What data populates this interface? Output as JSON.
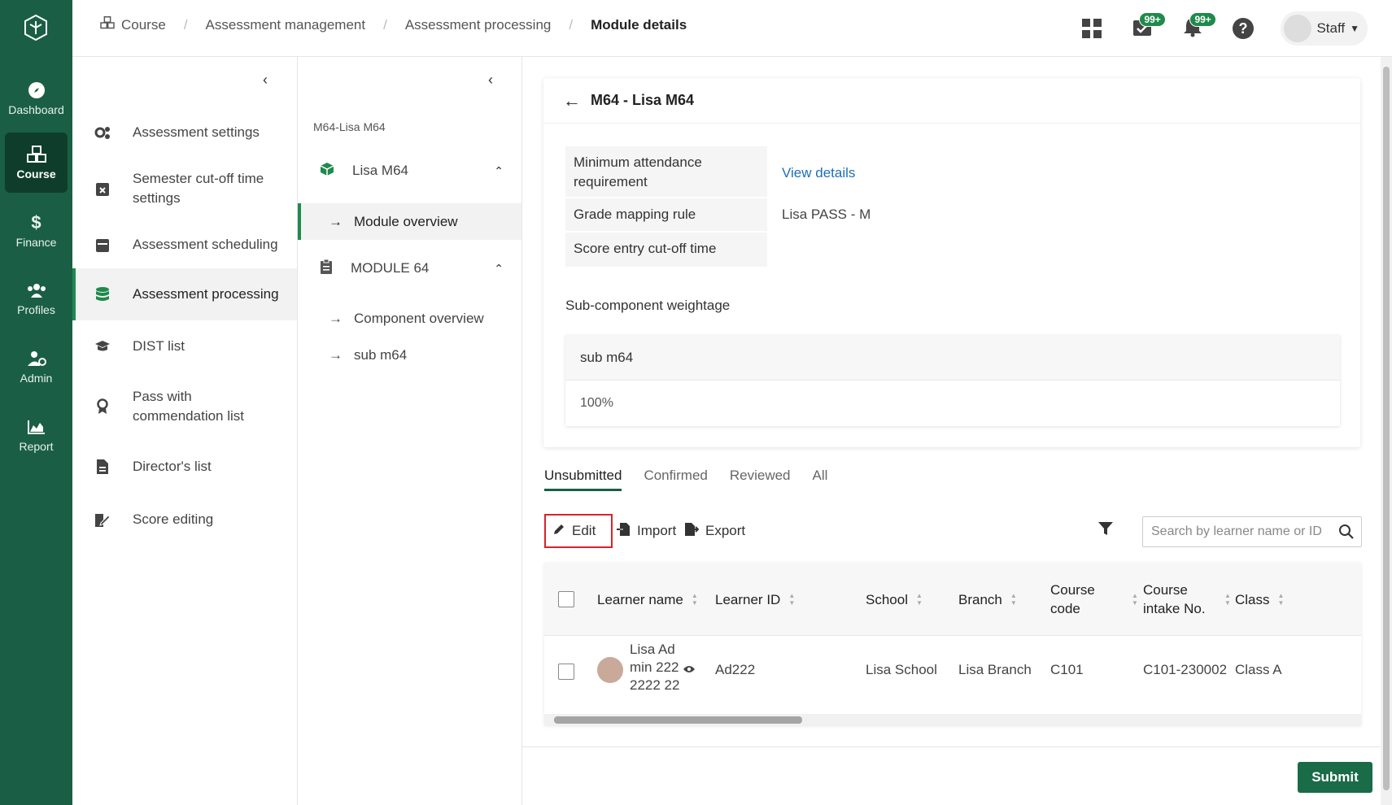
{
  "rail": {
    "items": [
      {
        "label": "Dashboard",
        "icon": "compass-icon"
      },
      {
        "label": "Course",
        "icon": "cubes-icon"
      },
      {
        "label": "Finance",
        "icon": "dollar-icon"
      },
      {
        "label": "Profiles",
        "icon": "users-icon"
      },
      {
        "label": "Admin",
        "icon": "user-gear-icon"
      },
      {
        "label": "Report",
        "icon": "area-chart-icon"
      }
    ]
  },
  "breadcrumb": [
    "Course",
    "Assessment management",
    "Assessment processing",
    "Module details"
  ],
  "header": {
    "badge_tasks": "99+",
    "badge_notifications": "99+",
    "user": "Staff"
  },
  "panel1": {
    "items": [
      "Assessment settings",
      "Semester cut-off time settings",
      "Assessment scheduling",
      "Assessment processing",
      "DIST list",
      "Pass with commendation list",
      "Director's list",
      "Score editing"
    ]
  },
  "panel2": {
    "title": "M64-Lisa M64",
    "module": "Lisa M64",
    "module_overview": "Module overview",
    "component_group": "MODULE 64",
    "component_overview": "Component overview",
    "sub": "sub m64"
  },
  "card": {
    "title": "M64 - Lisa M64",
    "labels": {
      "attendance": "Minimum attendance requirement",
      "grade_rule": "Grade mapping rule",
      "cutoff": "Score entry cut-off time"
    },
    "values": {
      "attendance": "View details",
      "grade_rule": "Lisa PASS - M",
      "cutoff": ""
    },
    "sub_weightage_label": "Sub-component weightage",
    "sub_name": "sub m64",
    "sub_value": "100%"
  },
  "tabs": [
    "Unsubmitted",
    "Confirmed",
    "Reviewed",
    "All"
  ],
  "toolbar": {
    "edit": "Edit",
    "import": "Import",
    "export": "Export",
    "search_placeholder": "Search by learner name or ID"
  },
  "table": {
    "columns": {
      "learner_name": "Learner name",
      "learner_id": "Learner ID",
      "school": "School",
      "branch": "Branch",
      "course_code": "Course code",
      "intake": "Course intake No.",
      "class": "Class"
    },
    "rows": [
      {
        "name": "Lisa Admin 2222222 22",
        "id": "Ad222",
        "school": "Lisa School",
        "branch": "Lisa Branch",
        "course_code": "C101",
        "intake": "C101-230002",
        "class": "Class A"
      }
    ]
  },
  "footer": {
    "submit": "Submit"
  }
}
